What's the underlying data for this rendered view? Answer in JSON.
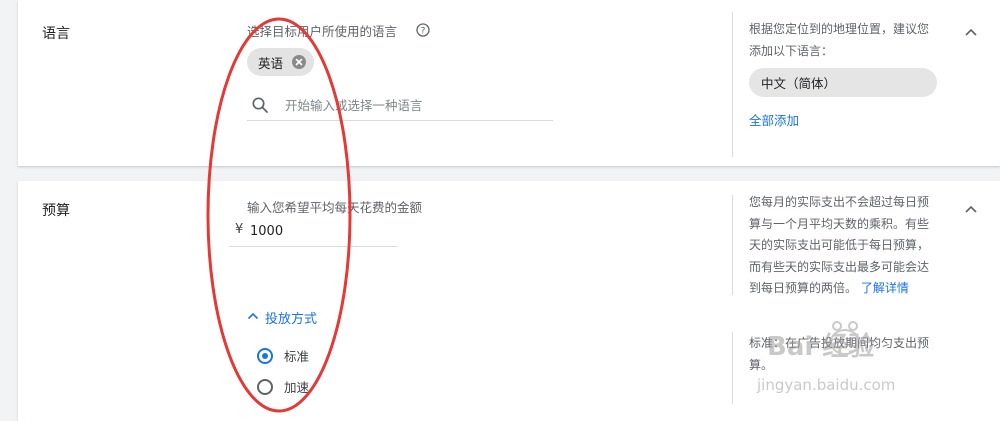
{
  "language_section": {
    "title": "语言",
    "hint": "选择目标用户所使用的语言",
    "selected_chips": [
      "英语"
    ],
    "search_placeholder": "开始输入或选择一种语言",
    "side_text_lines": [
      "根据您定位到的地理位置，建议您",
      "添加以下语言："
    ],
    "suggestion": "中文（简体）",
    "add_all": "全部添加"
  },
  "budget_section": {
    "title": "预算",
    "hint": "输入您希望平均每天花费的金额",
    "currency": "¥",
    "amount": "1000",
    "side_text_lines": [
      "您每月的实际支出不会超过每日预",
      "算与一个月平均天数的乘积。有些",
      "天的实际支出可能低于每日预算，",
      "而有些天的实际支出最多可能会达"
    ],
    "side_text_last": "到每日预算的两倍。",
    "learn_more": "了解详情",
    "delivery_label": "投放方式",
    "delivery_options": [
      {
        "label": "标准",
        "selected": true
      },
      {
        "label": "加速",
        "selected": false
      }
    ],
    "delivery_side_lines": [
      "标准：在广告投放期间均匀支出预",
      "算。"
    ]
  },
  "watermark": {
    "brand": "Bai 经验",
    "url": "jingyan.baidu.com"
  },
  "colors": {
    "accent": "#1a73e8",
    "annotation": "#e53935",
    "chip_bg": "#e3e3e3",
    "page_bg": "#f1f3f4"
  },
  "icons": [
    "help-circle-icon",
    "close-circle-icon",
    "search-icon",
    "chevron-up-icon",
    "radio-icon"
  ]
}
